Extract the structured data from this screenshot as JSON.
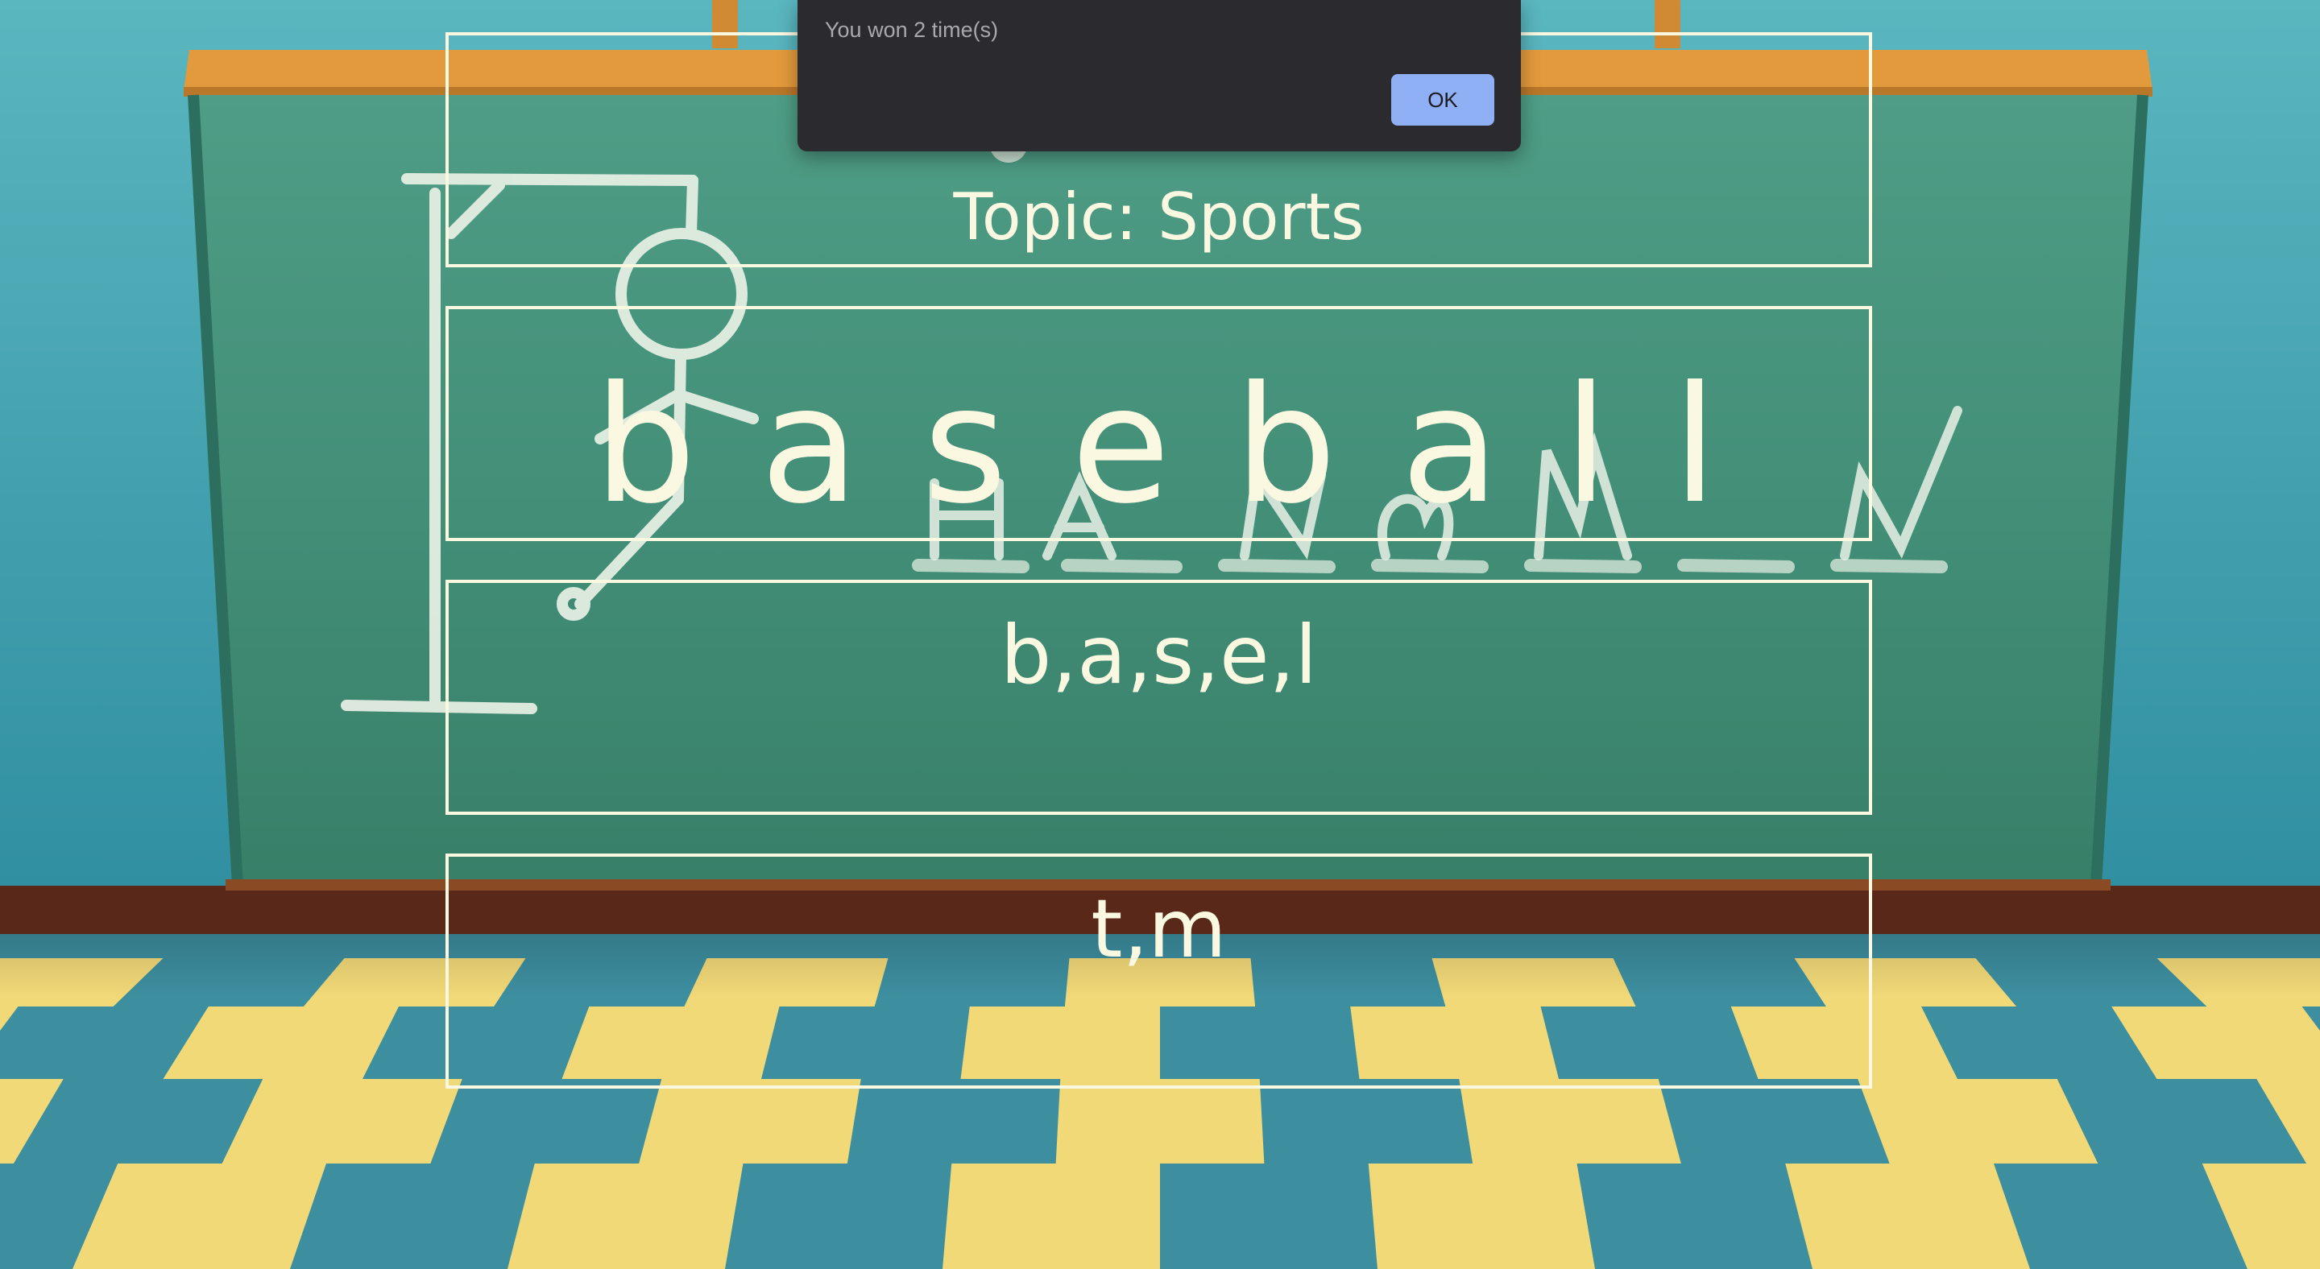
{
  "alert": {
    "message": "You won 2 time(s)",
    "ok_label": "OK"
  },
  "game": {
    "topic": "Topic: Sports",
    "word": "b a s e b a l l",
    "correct_guesses": "b,a,s,e,l",
    "wrong_guesses": "t,m"
  },
  "colors": {
    "text": "#fbf8e2",
    "box_border": "#fbf8e2",
    "chalkboard": "#3f8f76",
    "board_frame": "#e39a3c",
    "wall": "#3a9aa8",
    "floor_yellow": "#f2d978",
    "floor_blue": "#3d8fa0",
    "dialog_bg": "#2b2b2f",
    "ok_button": "#8fb0f4"
  },
  "background": {
    "chalk_title": "HANGMAN"
  }
}
